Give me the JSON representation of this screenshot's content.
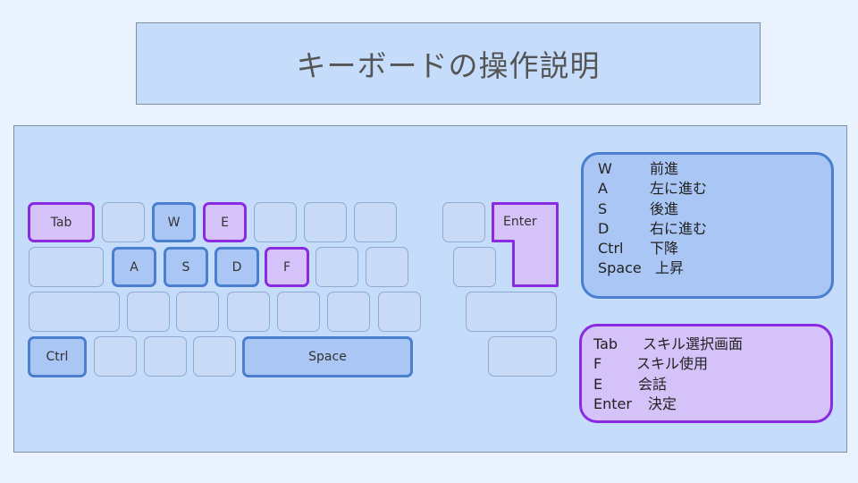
{
  "title": "キーボードの操作説明",
  "keys": {
    "tab": "Tab",
    "w": "W",
    "e": "E",
    "enter": "Enter",
    "a": "A",
    "s": "S",
    "d": "D",
    "f": "F",
    "ctrl": "Ctrl",
    "space": "Space"
  },
  "movement_legend": [
    {
      "key": "W",
      "action": "前進"
    },
    {
      "key": "A",
      "action": "左に進む"
    },
    {
      "key": "S",
      "action": "後進"
    },
    {
      "key": "D",
      "action": "右に進む"
    },
    {
      "key": "Ctrl",
      "action": "下降"
    },
    {
      "key": "Space",
      "action": "上昇"
    }
  ],
  "action_legend": [
    {
      "key": "Tab",
      "action": "スキル選択画面"
    },
    {
      "key": "F",
      "action": "スキル使用"
    },
    {
      "key": "E",
      "action": "会話"
    },
    {
      "key": "Enter",
      "action": "決定"
    }
  ],
  "colors": {
    "movement_border": "#4a7fd0",
    "action_border": "#8a2be2"
  }
}
